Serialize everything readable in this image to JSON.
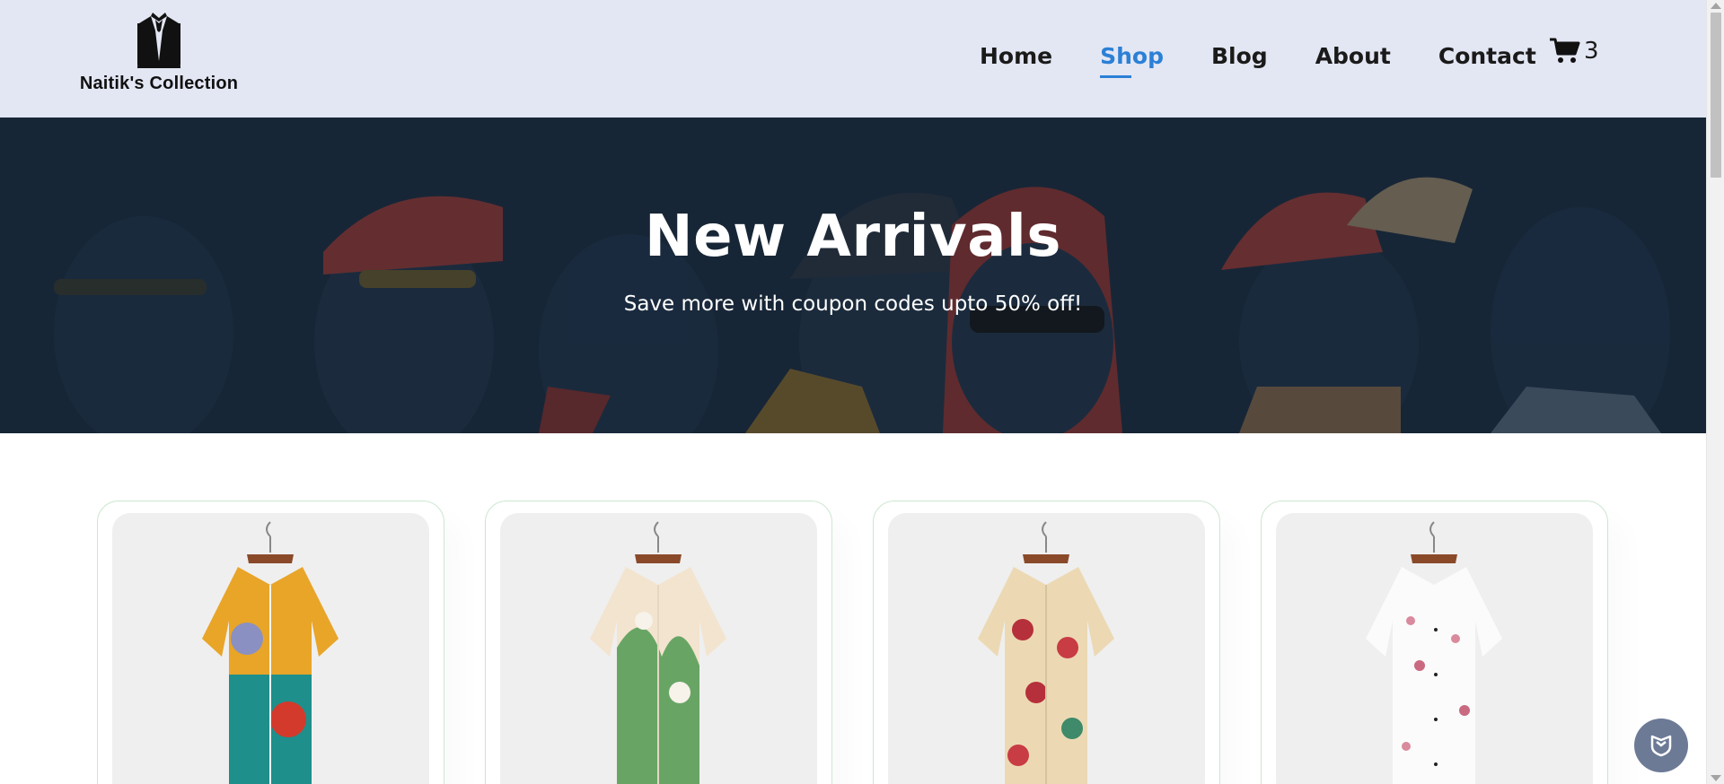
{
  "brand": {
    "name": "Naitik's Collection",
    "logo_icon": "suit-icon"
  },
  "nav": {
    "items": [
      {
        "label": "Home",
        "active": false
      },
      {
        "label": "Shop",
        "active": true
      },
      {
        "label": "Blog",
        "active": false
      },
      {
        "label": "About",
        "active": false
      },
      {
        "label": "Contact",
        "active": false
      }
    ],
    "cart": {
      "icon": "cart-icon",
      "count": "3"
    }
  },
  "hero": {
    "title": "New Arrivals",
    "subtitle": "Save more with coupon codes upto 50% off!"
  },
  "products": [
    {
      "image": "shirt-yellow-teal-abstract-floral"
    },
    {
      "image": "shirt-cream-green-leaf-floral"
    },
    {
      "image": "shirt-beige-red-rose-floral"
    },
    {
      "image": "shirt-white-pink-blossom"
    }
  ],
  "colors": {
    "header_bg": "#e3e6f3",
    "accent": "#2b80d6",
    "hero_overlay": "#1b2a3b",
    "card_border": "#cce7d0"
  },
  "floating_button": {
    "icon": "shield-icon"
  }
}
